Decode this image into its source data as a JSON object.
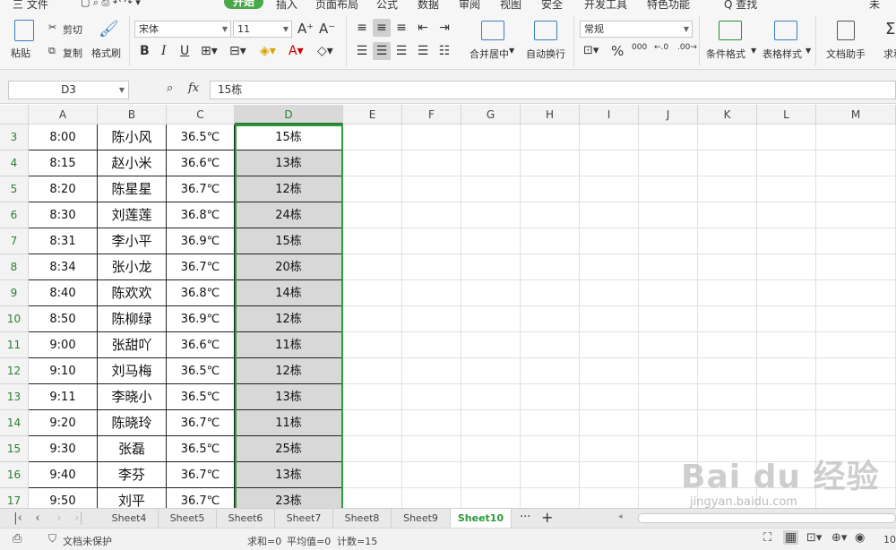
{
  "menubar": {
    "items": [
      "三 文件",
      "插入",
      "页面布局",
      "公式",
      "数据",
      "审阅",
      "视图",
      "安全",
      "开发工具",
      "特色功能",
      "Q 查找"
    ],
    "active": "开始",
    "right_text": "未"
  },
  "ribbon": {
    "paste_label": "粘贴",
    "cut_label": "剪切",
    "copy_label": "复制",
    "format_painter_label": "格式刷",
    "font_name": "宋体",
    "font_size": "11",
    "bold": "B",
    "italic": "I",
    "underline": "U",
    "merge_center_label": "合并居中",
    "wrap_text_label": "自动换行",
    "number_format": "常规",
    "percent": "%",
    "thousands": "000",
    "conditional_format_label": "条件格式",
    "table_style_label": "表格样式",
    "doc_assistant_label": "文档助手",
    "sum_label": "求和"
  },
  "formula_bar": {
    "name_box": "D3",
    "fx_label": "fx",
    "formula": "15栋"
  },
  "columns": [
    "A",
    "B",
    "C",
    "D",
    "E",
    "F",
    "G",
    "H",
    "I",
    "J",
    "K",
    "L",
    "M"
  ],
  "selected_column": "D",
  "rows": [
    {
      "num": "3",
      "a": "8:00",
      "b": "陈小风",
      "c": "36.5℃",
      "d": "15栋"
    },
    {
      "num": "4",
      "a": "8:15",
      "b": "赵小米",
      "c": "36.6℃",
      "d": "13栋"
    },
    {
      "num": "5",
      "a": "8:20",
      "b": "陈星星",
      "c": "36.7℃",
      "d": "12栋"
    },
    {
      "num": "6",
      "a": "8:30",
      "b": "刘莲莲",
      "c": "36.8℃",
      "d": "24栋"
    },
    {
      "num": "7",
      "a": "8:31",
      "b": "李小平",
      "c": "36.9℃",
      "d": "15栋"
    },
    {
      "num": "8",
      "a": "8:34",
      "b": "张小龙",
      "c": "36.7℃",
      "d": "20栋"
    },
    {
      "num": "9",
      "a": "8:40",
      "b": "陈欢欢",
      "c": "36.8℃",
      "d": "14栋"
    },
    {
      "num": "10",
      "a": "8:50",
      "b": "陈柳绿",
      "c": "36.9℃",
      "d": "12栋"
    },
    {
      "num": "11",
      "a": "9:00",
      "b": "张甜吖",
      "c": "36.6℃",
      "d": "11栋"
    },
    {
      "num": "12",
      "a": "9:10",
      "b": "刘马梅",
      "c": "36.5℃",
      "d": "12栋"
    },
    {
      "num": "13",
      "a": "9:11",
      "b": "李晓小",
      "c": "36.5℃",
      "d": "13栋"
    },
    {
      "num": "14",
      "a": "9:20",
      "b": "陈晓玲",
      "c": "36.7℃",
      "d": "11栋"
    },
    {
      "num": "15",
      "a": "9:30",
      "b": "张磊",
      "c": "36.5℃",
      "d": "25栋"
    },
    {
      "num": "16",
      "a": "9:40",
      "b": "李芬",
      "c": "36.7℃",
      "d": "13栋"
    },
    {
      "num": "17",
      "a": "9:50",
      "b": "刘平",
      "c": "36.7℃",
      "d": "23栋"
    }
  ],
  "sheet_tabs": [
    "Sheet4",
    "Sheet5",
    "Sheet6",
    "Sheet7",
    "Sheet8",
    "Sheet9",
    "Sheet10"
  ],
  "active_sheet": "Sheet10",
  "tab_more": "···",
  "tab_add": "+",
  "status": {
    "protect": "文档未保护",
    "sum": "求和=0",
    "average": "平均值=0",
    "count": "计数=15",
    "zoom": "10"
  },
  "watermark": {
    "brand": "Bai du 经验",
    "url": "jingyan.baidu.com"
  },
  "colors": {
    "accent_green": "#2e9a3a",
    "selection_gray": "#d8d8d8"
  }
}
